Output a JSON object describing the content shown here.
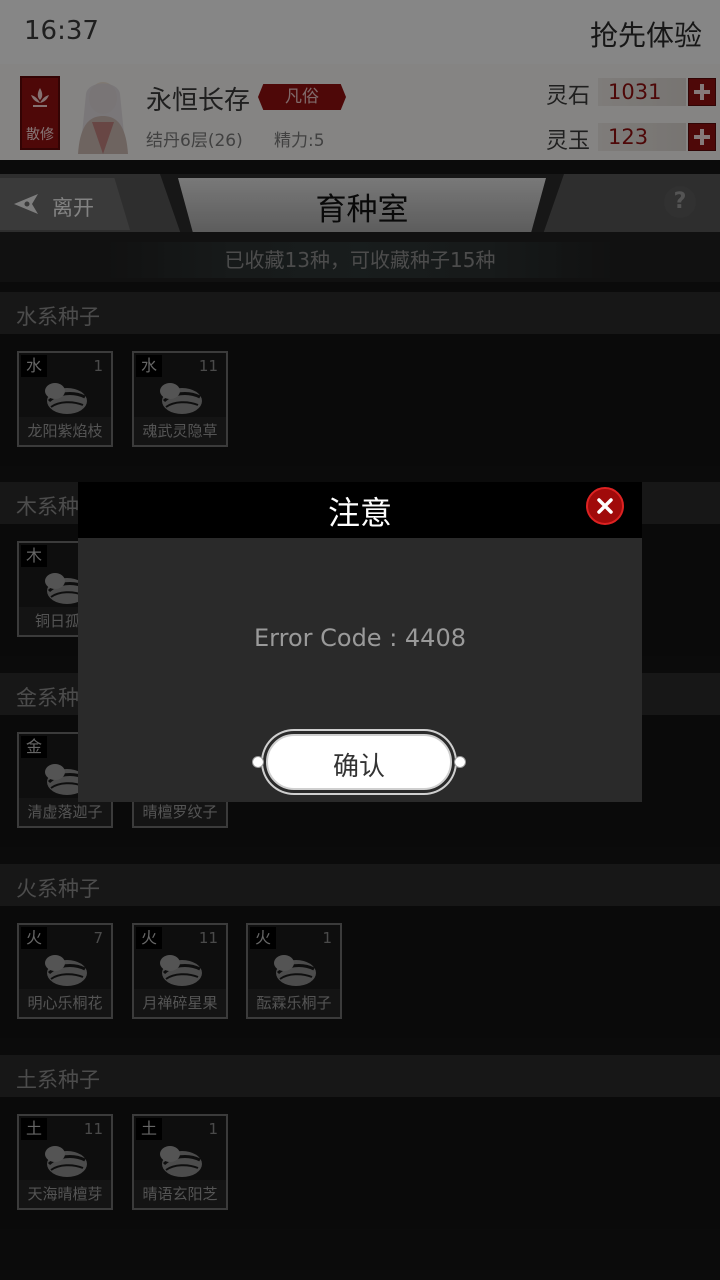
{
  "status_bar": {
    "time": "16:37",
    "early_access": "抢先体验"
  },
  "player": {
    "badge_label": "散修",
    "name": "永恒长存",
    "rank": "凡俗",
    "level": "结丹6层(26)",
    "energy": "精力:5",
    "currencies": [
      {
        "label": "灵石",
        "value": "1031"
      },
      {
        "label": "灵玉",
        "value": "123"
      }
    ]
  },
  "nav": {
    "leave_label": "离开",
    "title": "育种室",
    "help": "?"
  },
  "info": "已收藏13种，可收藏种子15种",
  "sections": [
    {
      "title": "水系种子",
      "seeds": [
        {
          "element": "水",
          "count": "1",
          "name": "龙阳紫焰枝"
        },
        {
          "element": "水",
          "count": "11",
          "name": "魂武灵隐草"
        }
      ]
    },
    {
      "title": "木系种子",
      "seeds": [
        {
          "element": "木",
          "count": "",
          "name": "铜日孤绿"
        }
      ]
    },
    {
      "title": "金系种子",
      "seeds": [
        {
          "element": "金",
          "count": "",
          "name": "清虚落迦子"
        },
        {
          "element": "",
          "count": "",
          "name": "晴檀罗纹子"
        }
      ]
    },
    {
      "title": "火系种子",
      "seeds": [
        {
          "element": "火",
          "count": "7",
          "name": "明心乐桐花"
        },
        {
          "element": "火",
          "count": "11",
          "name": "月禅碎星果"
        },
        {
          "element": "火",
          "count": "1",
          "name": "酝霖乐桐子"
        }
      ]
    },
    {
      "title": "土系种子",
      "seeds": [
        {
          "element": "土",
          "count": "11",
          "name": "天海晴檀芽"
        },
        {
          "element": "土",
          "count": "1",
          "name": "晴语玄阳芝"
        }
      ]
    }
  ],
  "dialog": {
    "title": "注意",
    "message": "Error Code : 4408",
    "confirm": "确认"
  },
  "colors": {
    "accent_red": "#8e1010",
    "dialog_bg": "#2a2a2a"
  },
  "icons": [
    "lotus-emblem-icon",
    "back-arrow-icon",
    "help-icon",
    "seed-icon",
    "close-icon",
    "plus-icon"
  ]
}
